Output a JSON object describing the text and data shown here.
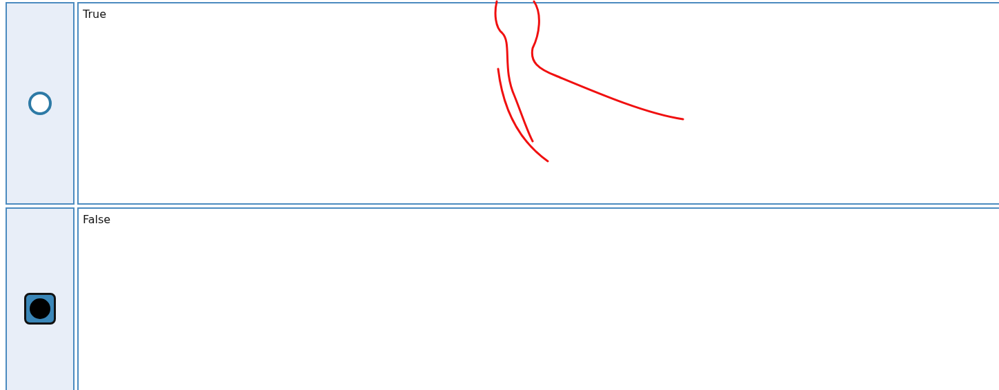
{
  "options": [
    {
      "label": "True",
      "selected": false
    },
    {
      "label": "False",
      "selected": true
    }
  ]
}
